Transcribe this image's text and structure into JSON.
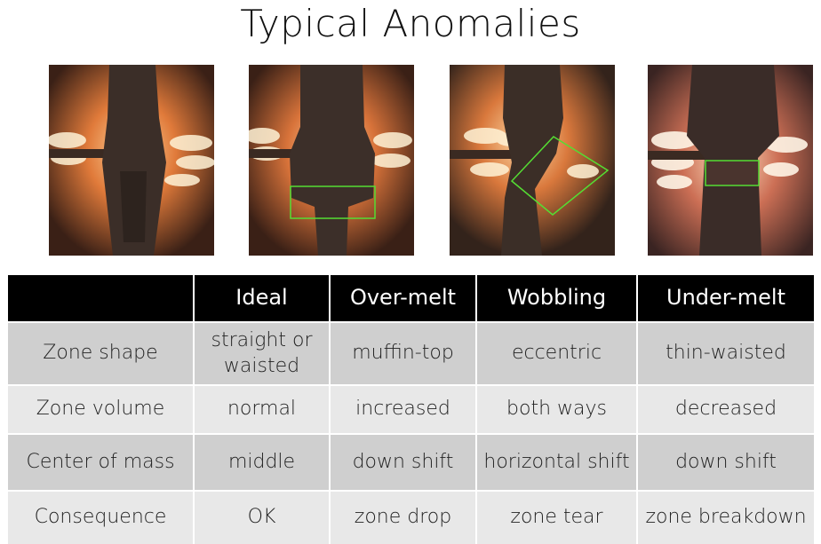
{
  "title": "Typical Anomalies",
  "images": [
    {
      "label": "ideal-zone-photo",
      "highlight": "none"
    },
    {
      "label": "over-melt-zone-photo",
      "highlight": "rectangle"
    },
    {
      "label": "wobbling-zone-photo",
      "highlight": "rotated-rectangle"
    },
    {
      "label": "under-melt-zone-photo",
      "highlight": "rectangle"
    }
  ],
  "highlight_color": "#55dd33",
  "table": {
    "headers": [
      "",
      "Ideal",
      "Over-melt",
      "Wobbling",
      "Under-melt"
    ],
    "rows": [
      {
        "label": "Zone shape",
        "cells": [
          "straight or waisted",
          "muffin-top",
          "eccentric",
          "thin-waisted"
        ]
      },
      {
        "label": "Zone volume",
        "cells": [
          "normal",
          "increased",
          "both ways",
          "decreased"
        ]
      },
      {
        "label": "Center of mass",
        "cells": [
          "middle",
          "down shift",
          "horizontal shift",
          "down shift"
        ]
      },
      {
        "label": "Consequence",
        "cells": [
          "OK",
          "zone drop",
          "zone tear",
          "zone breakdown"
        ]
      }
    ]
  }
}
